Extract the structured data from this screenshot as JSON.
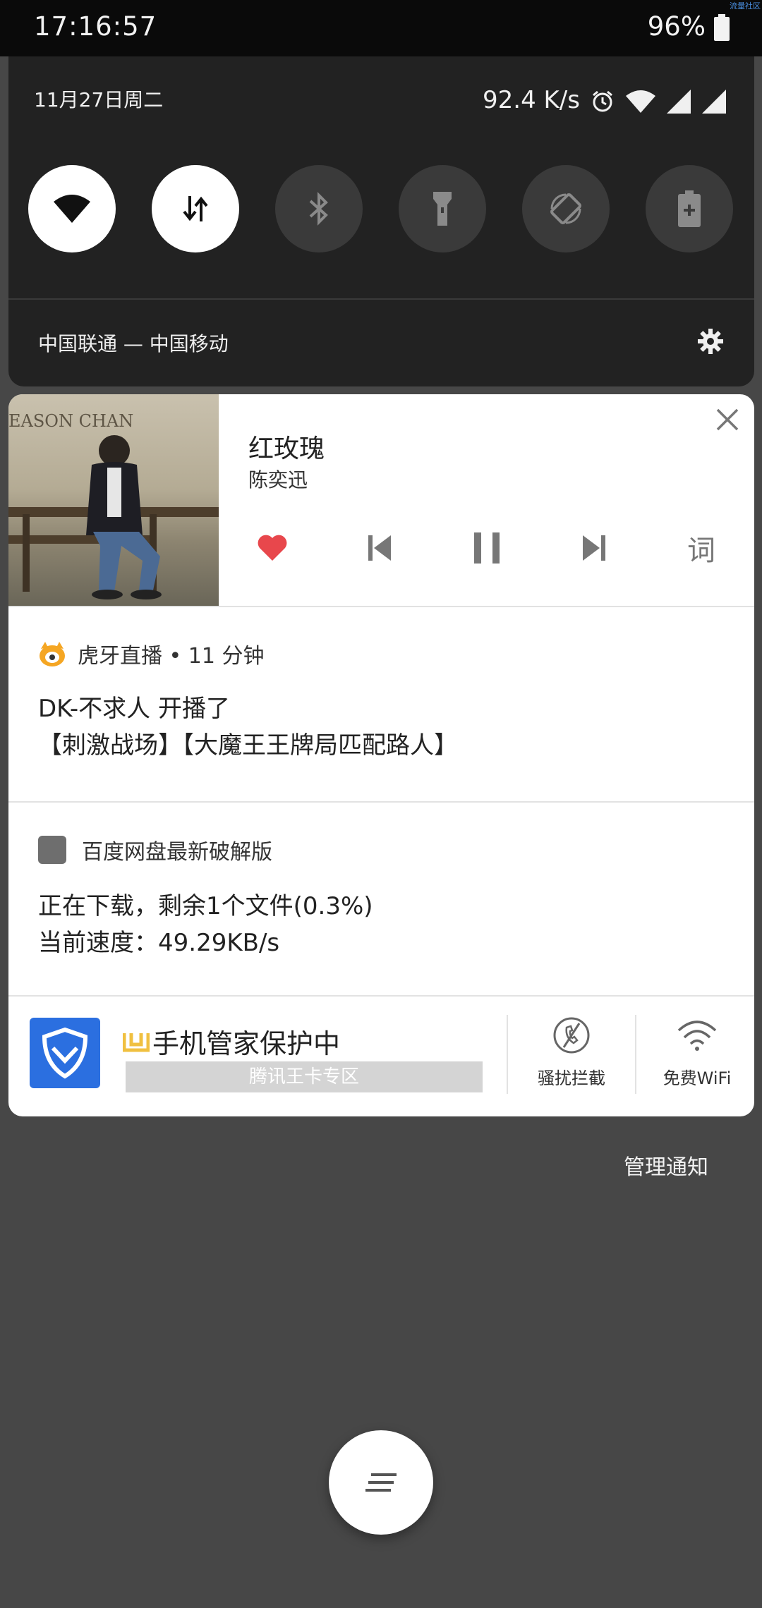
{
  "statusbar": {
    "time": "17:16:57",
    "battery": "96%",
    "corner_label": "流量社区"
  },
  "quick_settings": {
    "date": "11月27日周二",
    "net_speed": "92.4 K/s",
    "carrier": "中国联通 — 中国移动",
    "tiles": [
      {
        "name": "wifi",
        "state": "on"
      },
      {
        "name": "mobile-data",
        "state": "on"
      },
      {
        "name": "bluetooth",
        "state": "off"
      },
      {
        "name": "flashlight",
        "state": "off"
      },
      {
        "name": "auto-rotate",
        "state": "off"
      },
      {
        "name": "battery-saver",
        "state": "off"
      }
    ]
  },
  "media": {
    "title": "红玫瑰",
    "artist": "陈奕迅",
    "album_text": "EASON CHAN",
    "lyric_btn": "词",
    "accent": "#e8474c"
  },
  "huya": {
    "app": "虎牙直播 • 11 分钟",
    "line1": "DK-不求人 开播了",
    "line2": "【刺激战场】【大魔王王牌局匹配路人】"
  },
  "baidu": {
    "app": "百度网盘最新破解版",
    "line1": "正在下载，剩余1个文件(0.3%)",
    "line2": "当前速度：49.29KB/s"
  },
  "guard": {
    "title": "手机管家保护中",
    "banner": "腾讯王卡专区",
    "btn1": "骚扰拦截",
    "btn2": "免费WiFi"
  },
  "manage_label": "管理通知"
}
